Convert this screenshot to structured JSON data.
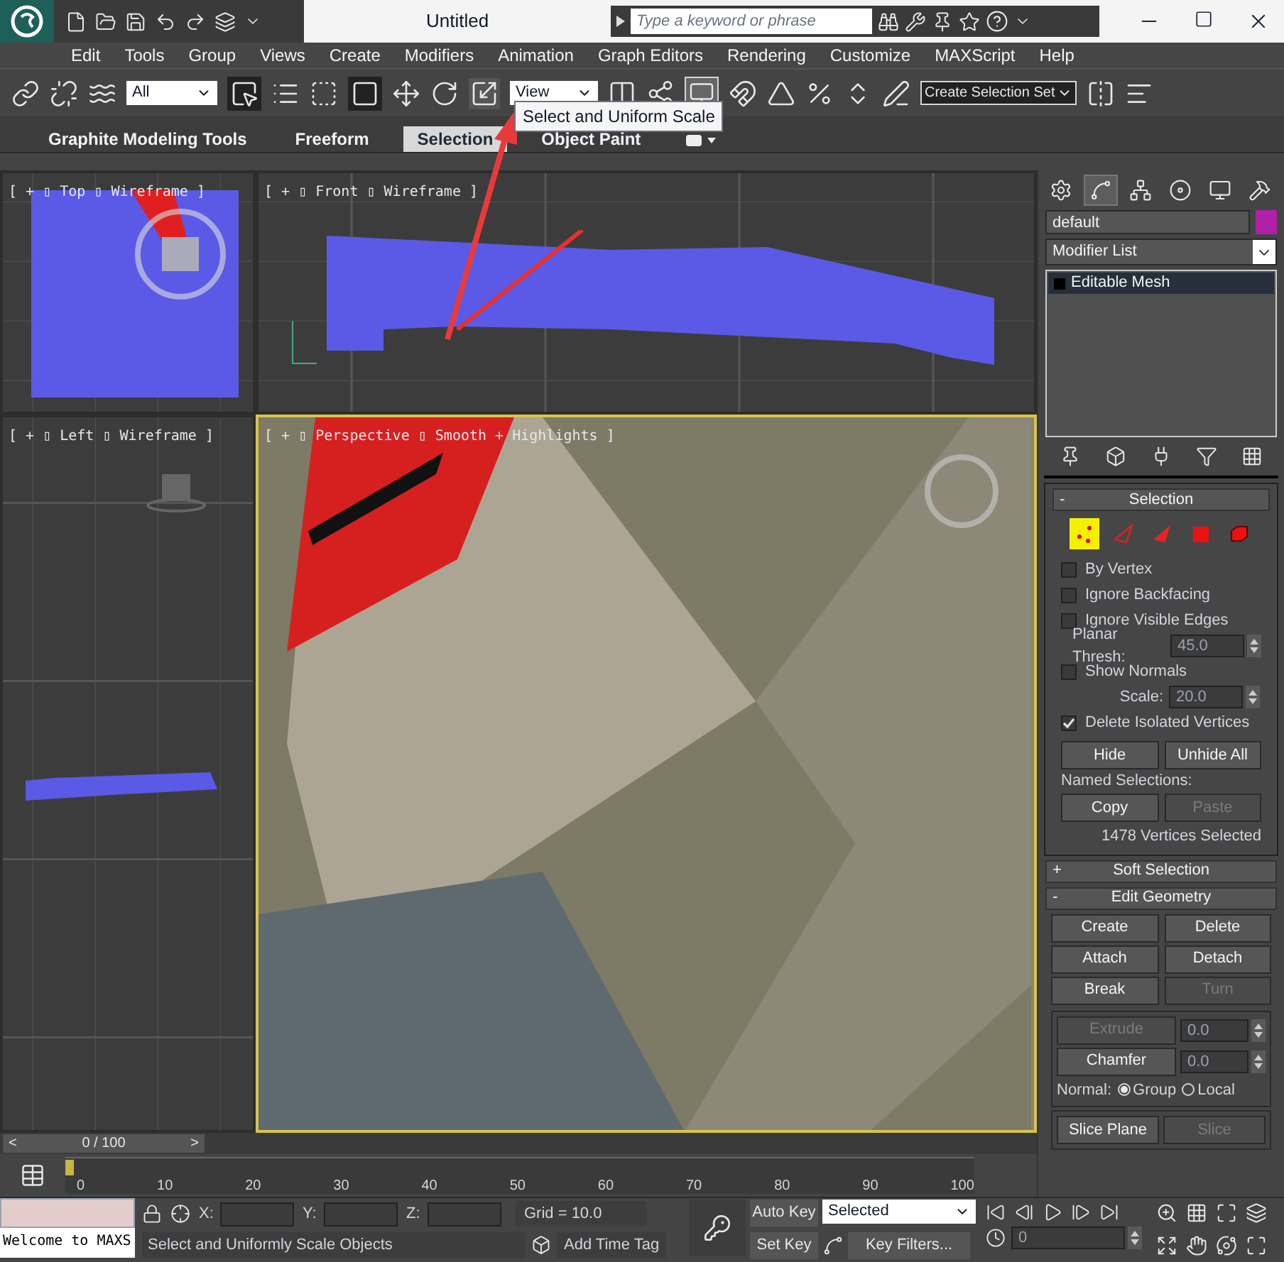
{
  "title_bar": {
    "title": "Untitled",
    "search": {
      "placeholder": "Type a keyword or phrase"
    }
  },
  "menu": [
    "Edit",
    "Tools",
    "Group",
    "Views",
    "Create",
    "Modifiers",
    "Animation",
    "Graph Editors",
    "Rendering",
    "Customize",
    "MAXScript",
    "Help"
  ],
  "toolbar": {
    "selection_filter": "All",
    "reference_coord": "View",
    "named_selection": "Create Selection Set",
    "tooltip": "Select and Uniform Scale"
  },
  "ribbon_tabs": [
    {
      "label": "Graphite Modeling Tools",
      "selected": false
    },
    {
      "label": "Freeform",
      "selected": false
    },
    {
      "label": "Selection",
      "selected": true
    },
    {
      "label": "Object Paint",
      "selected": false
    }
  ],
  "viewports": [
    {
      "kind": "top",
      "label": "[ + ▯ Top ▯ Wireframe ]",
      "active": false
    },
    {
      "kind": "front",
      "label": "[ + ▯ Front ▯ Wireframe ]",
      "active": false
    },
    {
      "kind": "left",
      "label": "[ + ▯ Left ▯ Wireframe ]",
      "active": false
    },
    {
      "kind": "perspective",
      "label": "[ + ▯ Perspective ▯ Smooth + Highlights ]",
      "active": true
    }
  ],
  "command_panel": {
    "tabs": [
      {
        "selected": false
      },
      {
        "selected": true
      },
      {
        "selected": false
      },
      {
        "selected": false
      },
      {
        "selected": false
      },
      {
        "selected": false
      }
    ],
    "object": {
      "name": "default",
      "color": "#b01fa6"
    },
    "modifier_list": "Modifier List",
    "stack": [
      {
        "label": "Editable Mesh",
        "selected": true
      }
    ],
    "selection": {
      "toggle": "-",
      "title": "Selection",
      "levels": [
        {
          "selected": true
        },
        {
          "selected": false
        },
        {
          "selected": false
        },
        {
          "selected": false
        },
        {
          "selected": false
        }
      ],
      "checkboxes": [
        {
          "label": "By Vertex",
          "checked": false
        },
        {
          "label": "Ignore Backfacing",
          "checked": false
        },
        {
          "label": "Ignore Visible Edges",
          "checked": false
        }
      ],
      "planar_thresh": {
        "label": "Planar Thresh:",
        "value": "45.0"
      },
      "show_normals": {
        "label": "Show Normals",
        "checked": false
      },
      "scale": {
        "label": "Scale:",
        "value": "20.0"
      },
      "delete_isolated": {
        "label": "Delete Isolated Vertices",
        "checked": true
      },
      "buttons": [
        {
          "label": "Hide",
          "disabled": false
        },
        {
          "label": "Unhide All",
          "disabled": false
        }
      ],
      "named_selections_label": "Named Selections:",
      "named_buttons": [
        {
          "label": "Copy",
          "disabled": false
        },
        {
          "label": "Paste",
          "disabled": true
        }
      ],
      "status": "1478 Vertices Selected"
    },
    "soft_selection": {
      "toggle": "+",
      "title": "Soft Selection"
    },
    "edit_geometry": {
      "toggle": "-",
      "title": "Edit Geometry",
      "buttons": [
        {
          "label": "Create",
          "disabled": false
        },
        {
          "label": "Delete",
          "disabled": false
        },
        {
          "label": "Attach",
          "disabled": false
        },
        {
          "label": "Detach",
          "disabled": false
        },
        {
          "label": "Break",
          "disabled": false
        },
        {
          "label": "Turn",
          "disabled": true
        }
      ],
      "spinners": [
        {
          "label": "Extrude",
          "value": "0.0",
          "disabled": true
        },
        {
          "label": "Chamfer",
          "value": "0.0",
          "disabled": false
        }
      ],
      "normal_label": "Normal:",
      "normal_options": [
        {
          "label": "Group",
          "selected": true
        },
        {
          "label": "Local",
          "selected": false
        }
      ],
      "slice_buttons": [
        {
          "label": "Slice Plane",
          "disabled": false
        },
        {
          "label": "Slice",
          "disabled": true
        }
      ]
    }
  },
  "time_slider": {
    "prev": "<",
    "frame": "0 / 100",
    "next": ">",
    "level": 0
  },
  "track_ticks": [
    "0",
    "10",
    "20",
    "30",
    "40",
    "50",
    "60",
    "70",
    "80",
    "90",
    "100"
  ],
  "status_bar": {
    "listener": "Welcome to MAXS",
    "coords": [
      {
        "label": "X:"
      },
      {
        "label": "Y:"
      },
      {
        "label": "Z:"
      }
    ],
    "grid": "Grid = 10.0",
    "prompt": "Select and Uniformly Scale Objects",
    "add_time_tag": "Add Time Tag",
    "auto_key": "Auto Key",
    "set_key": "Set Key",
    "key_mode": "Selected",
    "key_filters": "Key Filters...",
    "current_frame": "0"
  }
}
